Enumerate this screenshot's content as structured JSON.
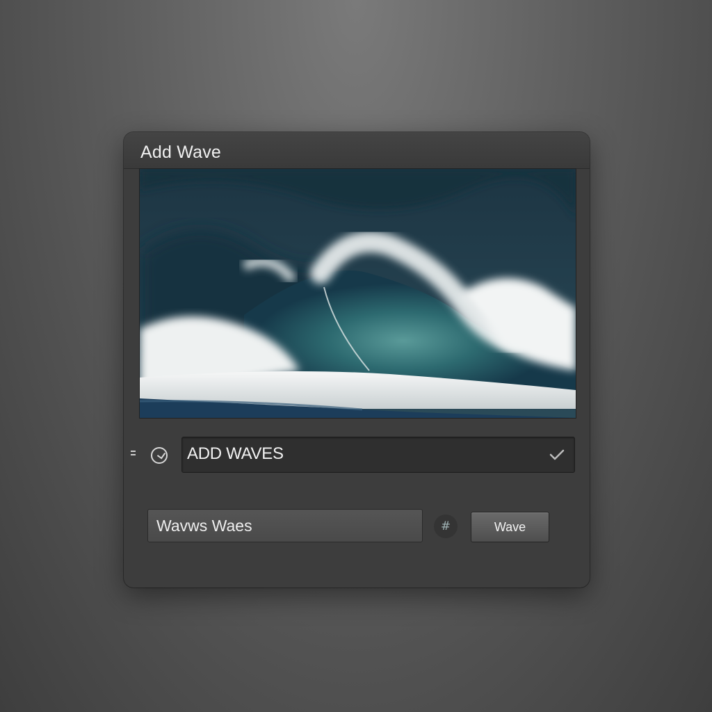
{
  "dialog": {
    "title": "Add Wave",
    "preview_image": "ocean-wave-photo"
  },
  "wave_type_select": {
    "value": "ADD WAVES",
    "indicator_icon": "check-icon"
  },
  "name_input": {
    "value": "Wavws Waes"
  },
  "wave_button": {
    "label": "Wave"
  },
  "icons": {
    "drag": "drag-handle-icon",
    "clock": "clock-icon",
    "hash": "hash-icon"
  },
  "colors": {
    "dialog_bg": "#3d3d3d",
    "titlebar_bg": "#444444",
    "page_bg": "#5e5e5e",
    "water": "#2f6e72"
  }
}
